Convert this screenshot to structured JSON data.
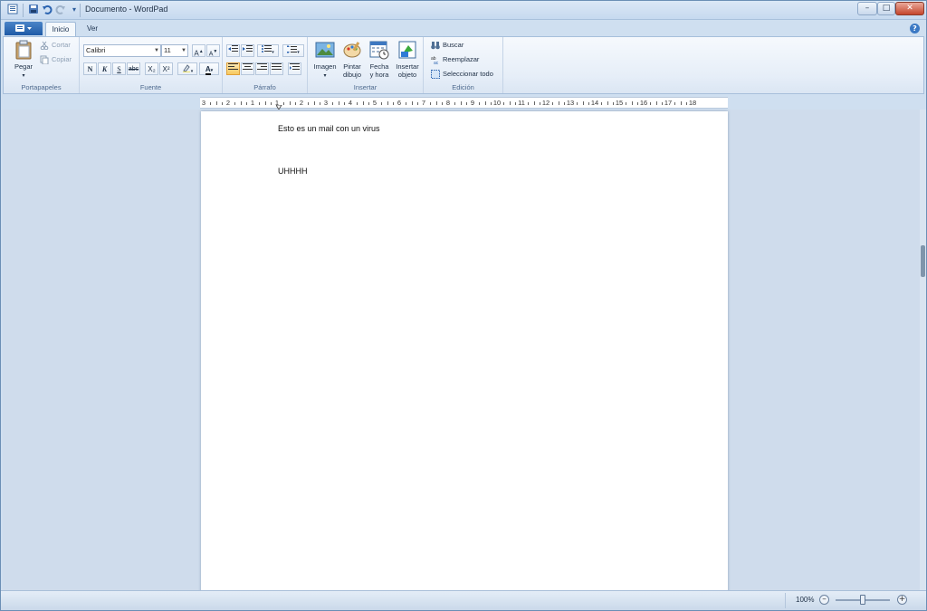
{
  "window": {
    "title": "Documento - WordPad"
  },
  "quick_access": {
    "icons": [
      "wordpad-icon",
      "save-icon",
      "undo-icon",
      "redo-icon",
      "customize-icon"
    ]
  },
  "title_buttons": {
    "minimize": "–",
    "maximize": "□",
    "close": "✕"
  },
  "tabs": [
    {
      "label": "Inicio"
    },
    {
      "label": "Ver"
    }
  ],
  "ribbon": {
    "clipboard": {
      "label": "Portapapeles",
      "paste": "Pegar",
      "cut": "Cortar",
      "copy": "Copiar"
    },
    "font": {
      "label": "Fuente",
      "family": "Calibri",
      "size": "11",
      "bold": "N",
      "italic": "K",
      "underline": "S",
      "strike": "abc",
      "sub": "X₂",
      "sup": "X²",
      "grow": "A",
      "shrink": "A",
      "color": "A"
    },
    "paragraph": {
      "label": "Párrafo"
    },
    "insert": {
      "label": "Insertar",
      "image": "Imagen",
      "paint_1": "Pintar",
      "paint_2": "dibujo",
      "date_1": "Fecha",
      "date_2": "y hora",
      "object_1": "Insertar",
      "object_2": "objeto"
    },
    "editing": {
      "label": "Edición",
      "find": "Buscar",
      "replace": "Reemplazar",
      "select_all": "Seleccionar todo"
    }
  },
  "ruler": {
    "labels": [
      "3",
      "2",
      "1",
      "1",
      "2",
      "3",
      "4",
      "5",
      "6",
      "7",
      "8",
      "9",
      "10",
      "11",
      "12",
      "13",
      "14",
      "15",
      "16",
      "17",
      "18"
    ]
  },
  "document": {
    "lines": [
      "Esto es un mail con un virus",
      "UHHHH"
    ]
  },
  "status": {
    "zoom": "100%",
    "zoom_out": "–",
    "zoom_in": "+"
  },
  "colors": {
    "ribbon_bg": "#e6eef8",
    "accent": "#1f5aa6",
    "active_button": "#f7c95f"
  }
}
